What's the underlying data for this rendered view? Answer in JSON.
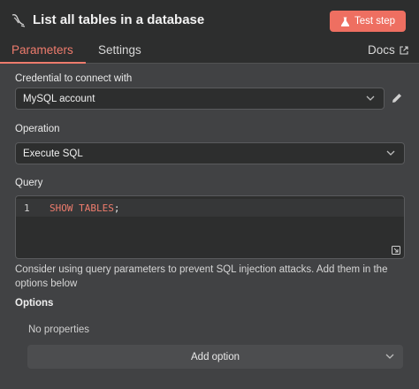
{
  "header": {
    "title": "List all tables in a database",
    "test_step_label": "Test step"
  },
  "tabs": {
    "parameters": "Parameters",
    "settings": "Settings",
    "docs": "Docs"
  },
  "credential": {
    "label": "Credential to connect with",
    "value": "MySQL account"
  },
  "operation": {
    "label": "Operation",
    "value": "Execute SQL"
  },
  "query": {
    "label": "Query",
    "line_number": "1",
    "code_keyword": "SHOW TABLES",
    "code_punct": ";"
  },
  "hint": "Consider using query parameters to prevent SQL injection attacks. Add them in the options below",
  "options": {
    "title": "Options",
    "empty_text": "No properties",
    "add_label": "Add option"
  },
  "colors": {
    "accent": "#ee6f61",
    "background": "#414244",
    "panel": "#2d2e2e"
  }
}
